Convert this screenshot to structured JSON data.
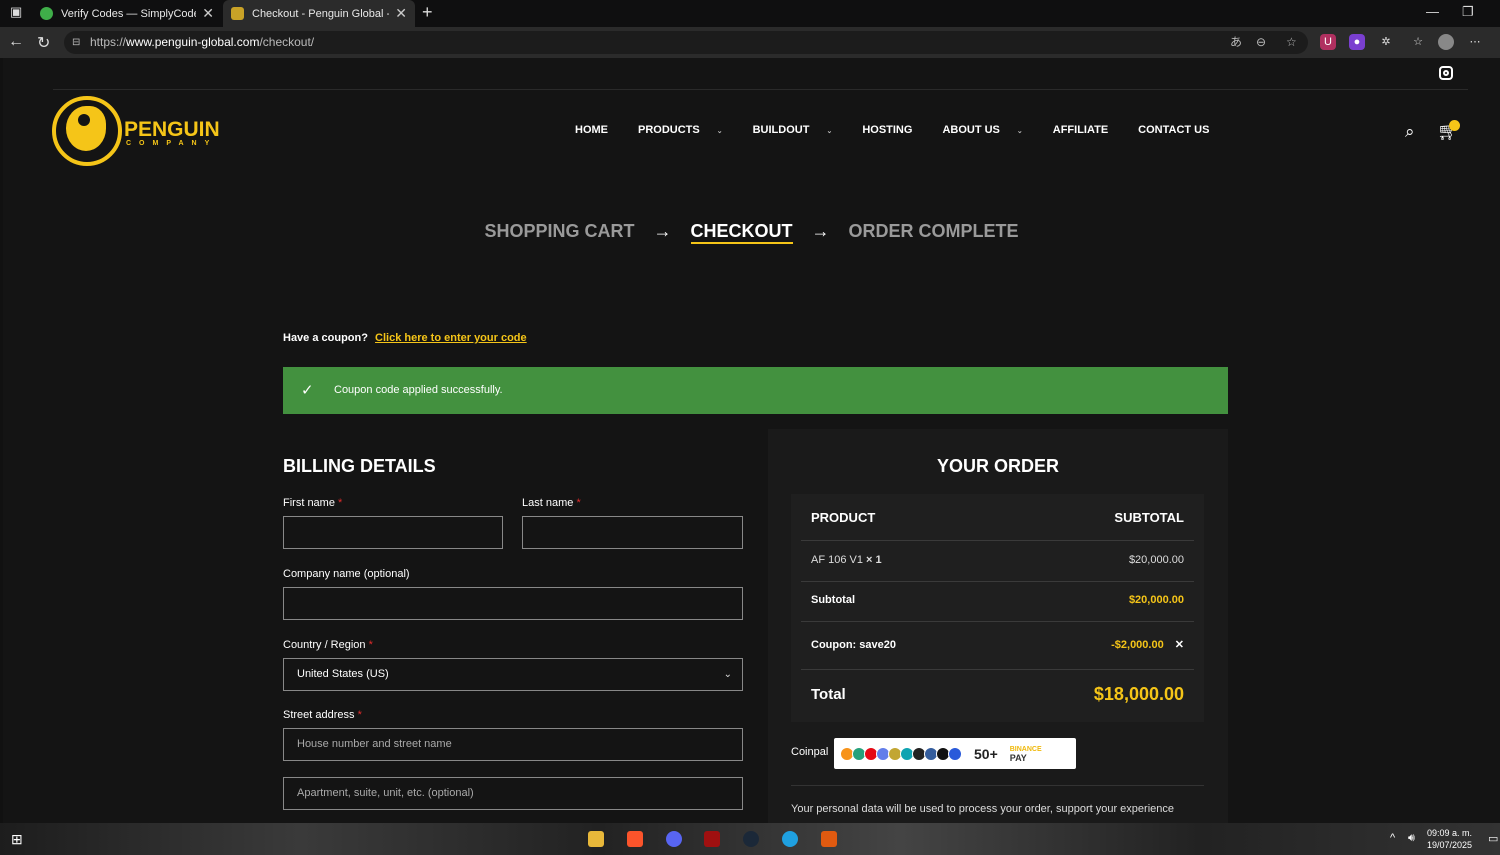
{
  "browser": {
    "tabs": [
      {
        "title": "Verify Codes — SimplyCodes",
        "icon": "simplycodes-icon"
      },
      {
        "title": "Checkout - Penguin Global - Cryp",
        "icon": "penguin-icon"
      }
    ],
    "url_prefix": "https://",
    "url_host": "www.penguin-global.com",
    "url_path": "/checkout/"
  },
  "site": {
    "logo_text": "PENGUIN",
    "logo_sub": "COMPANY",
    "nav": [
      {
        "label": "HOME",
        "dropdown": false
      },
      {
        "label": "PRODUCTS",
        "dropdown": true
      },
      {
        "label": "BUILDOUT",
        "dropdown": true
      },
      {
        "label": "HOSTING",
        "dropdown": false
      },
      {
        "label": "ABOUT US",
        "dropdown": true
      },
      {
        "label": "AFFILIATE",
        "dropdown": false
      },
      {
        "label": "CONTACT US",
        "dropdown": false
      }
    ]
  },
  "steps": {
    "cart": "SHOPPING CART",
    "checkout": "CHECKOUT",
    "complete": "ORDER COMPLETE",
    "arrow": "→"
  },
  "coupon": {
    "prompt": "Have a coupon?",
    "link": "Click here to enter your code",
    "notice": "Coupon code applied successfully."
  },
  "billing": {
    "title": "BILLING DETAILS",
    "first_name": "First name",
    "last_name": "Last name",
    "company": "Company name (optional)",
    "country_label": "Country / Region",
    "country_value": "United States (US)",
    "street_label": "Street address",
    "street_placeholder": "House number and street name",
    "apt_placeholder": "Apartment, suite, unit, etc. (optional)",
    "req": "*"
  },
  "order": {
    "title": "YOUR ORDER",
    "col_product": "PRODUCT",
    "col_subtotal": "SUBTOTAL",
    "item_name": "AF 106 V1",
    "item_qty": "× 1",
    "item_price": "$20,000.00",
    "subtotal_label": "Subtotal",
    "subtotal_value": "$20,000.00",
    "coupon_label": "Coupon: save20",
    "coupon_value": "-$2,000.00",
    "total_label": "Total",
    "total_value": "$18,000.00"
  },
  "payment": {
    "method": "Coinpal",
    "more": "50+",
    "binance_top": "BINANCE",
    "binance_bottom": "PAY",
    "privacy": "Your personal data will be used to process your order, support your experience"
  },
  "taskbar": {
    "time": "09:09 a. m.",
    "date": "19/07/2025"
  },
  "colors": {
    "accent": "#f5c518",
    "success": "#43913f",
    "required": "#e02b2b"
  }
}
